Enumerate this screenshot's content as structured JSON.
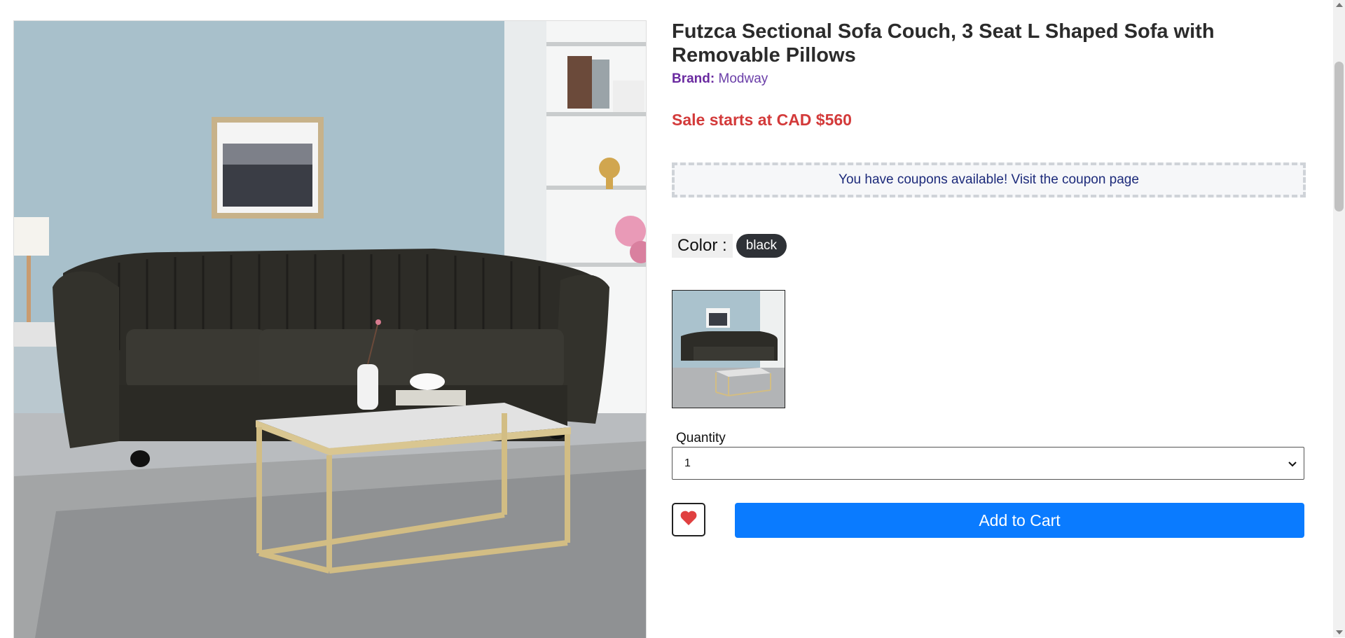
{
  "product": {
    "title": "Futzca Sectional Sofa Couch, 3 Seat L Shaped Sofa with Removable Pillows",
    "brand_label": "Brand:",
    "brand_value": "Modway",
    "sale_text": "Sale starts at CAD $560",
    "coupon_text": "You have coupons available! Visit the coupon page",
    "color_label": "Color :",
    "color_value": "black",
    "quantity_label": "Quantity",
    "quantity_value": "1",
    "add_to_cart_label": "Add to Cart"
  },
  "colors": {
    "accent_blue": "#0a7bff",
    "sale_red": "#d33a3a",
    "brand_purple": "#6a2aa0",
    "wish_heart": "#e04040"
  },
  "icons": {
    "wishlist": "heart-icon",
    "select": "chevron-down-icon"
  }
}
